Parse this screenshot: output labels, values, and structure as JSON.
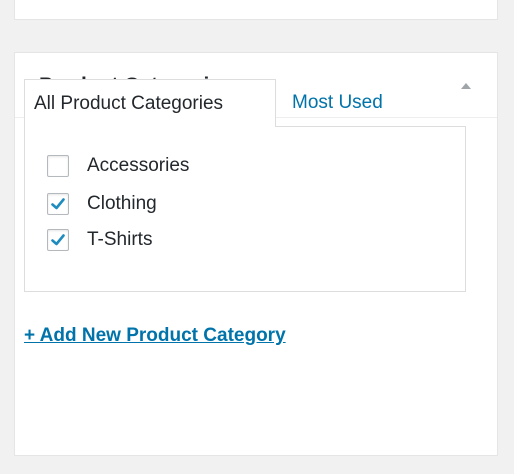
{
  "metabox": {
    "title": "Product Categories",
    "toggle_icon": "triangle-up-icon"
  },
  "tabs": [
    {
      "label": "All Product Categories",
      "active": true
    },
    {
      "label": "Most Used",
      "active": false
    }
  ],
  "categories": [
    {
      "label": "Accessories",
      "checked": false
    },
    {
      "label": "Clothing",
      "checked": true
    },
    {
      "label": "T-Shirts",
      "checked": true
    }
  ],
  "add_new_link": "+ Add New Product Category",
  "colors": {
    "link": "#0073aa",
    "check": "#1e8cbe",
    "background": "#f1f1f1",
    "border": "#dddddd"
  }
}
